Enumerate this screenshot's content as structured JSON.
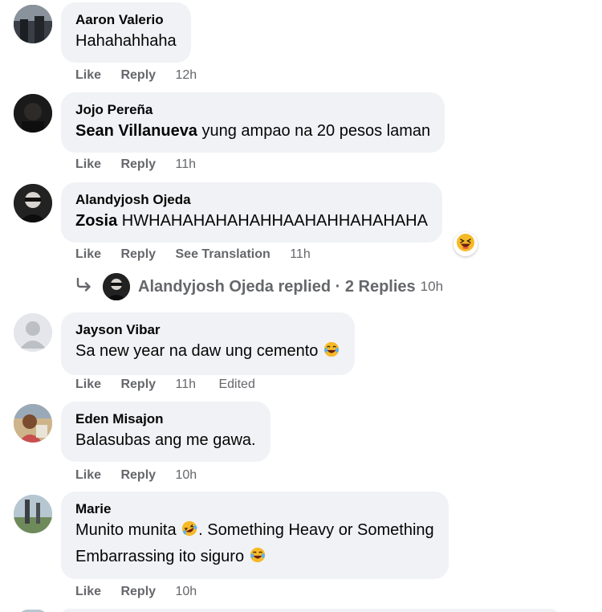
{
  "comments": [
    {
      "author": "Aaron Valerio",
      "text": "Hahahahhaha",
      "actions": {
        "like": "Like",
        "reply": "Reply",
        "time": "12h"
      }
    },
    {
      "author": "Jojo Pereña",
      "mention": "Sean Villanueva",
      "text": " yung ampao na 20 pesos laman",
      "actions": {
        "like": "Like",
        "reply": "Reply",
        "time": "11h"
      }
    },
    {
      "author": "Alandyjosh Ojeda",
      "mention": "Zosia",
      "text": " HWHAHAHAHAHAHHAAHAHHAHAHAHA",
      "reaction": "laughing-squint-emoji",
      "actions": {
        "like": "Like",
        "reply": "Reply",
        "translate": "See Translation",
        "time": "11h"
      },
      "replies": {
        "text": "Alandyjosh Ojeda replied · 2 Replies",
        "time": "10h"
      }
    },
    {
      "author": "Jayson Vibar",
      "text": "Sa new year na daw ung cemento ",
      "emoji": "tears-of-joy-emoji",
      "actions": {
        "like": "Like",
        "reply": "Reply",
        "time": "11h",
        "edited": "Edited"
      }
    },
    {
      "author": "Eden Misajon",
      "text": "Balasubas ang me gawa.",
      "actions": {
        "like": "Like",
        "reply": "Reply",
        "time": "10h"
      }
    },
    {
      "author": "Marie",
      "text_line1_a": "Munito munita ",
      "text_line1_b": ". Something Heavy or Something",
      "text_line2": "Embarrassing ito siguro ",
      "emoji": "rolling-laughing-emoji",
      "emoji2": "tears-of-joy-emoji",
      "actions": {
        "like": "Like",
        "reply": "Reply",
        "time": "10h"
      }
    }
  ],
  "colors": {
    "bubble": "#f0f2f5",
    "meta": "#65676b",
    "text": "#050505"
  }
}
